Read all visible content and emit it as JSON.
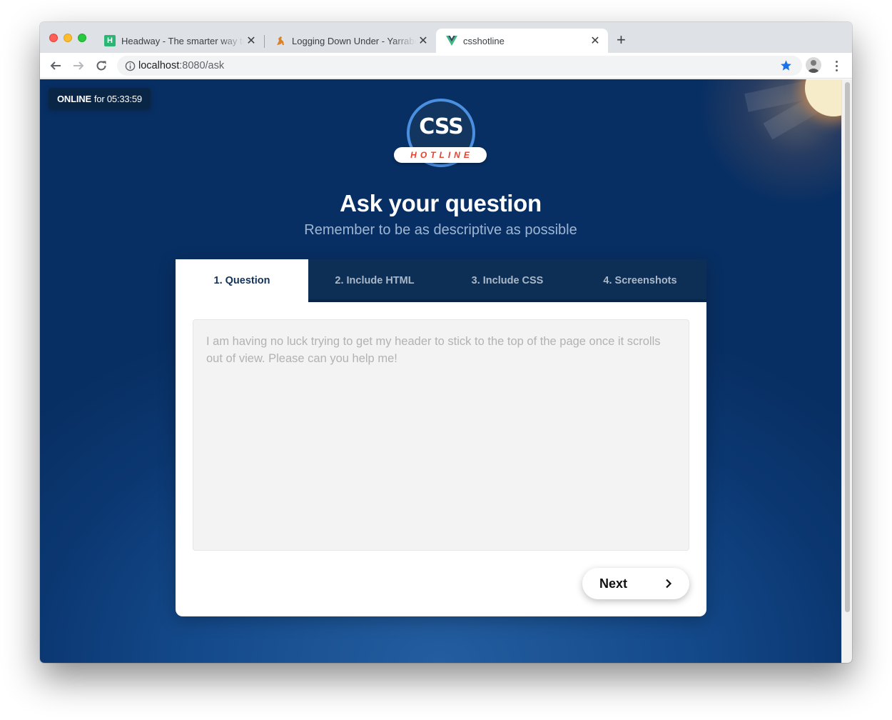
{
  "browser": {
    "tabs": [
      {
        "title": "Headway - The smarter way to",
        "active": false,
        "favicon": "headway-icon"
      },
      {
        "title": "Logging Down Under - Yarraberg",
        "active": false,
        "favicon": "kangaroo-icon"
      },
      {
        "title": "csshotline",
        "active": true,
        "favicon": "vue-icon"
      }
    ],
    "close_glyph": "✕",
    "new_tab_glyph": "+",
    "url_host": "localhost",
    "url_rest": ":8080/ask"
  },
  "page": {
    "status_state": "ONLINE",
    "status_duration": "for 05:33:59",
    "logo_main": "CSS",
    "logo_sub": "HOTLINE",
    "title": "Ask your question",
    "subtitle": "Remember to be as descriptive as possible",
    "steps": [
      {
        "label": "1. Question",
        "active": true
      },
      {
        "label": "2. Include HTML",
        "active": false
      },
      {
        "label": "3. Include CSS",
        "active": false
      },
      {
        "label": "4. Screenshots",
        "active": false
      }
    ],
    "question_placeholder": "I am having no luck trying to get my header to stick to the top of the page once it scrolls out of view. Please can you help me!",
    "next_label": "Next"
  },
  "colors": {
    "background_dark": "#082f63",
    "background_light": "#245ea0",
    "tab_bar": "#0d2e55",
    "logo_ring": "#4a8fe0",
    "logo_sub": "#e8402f"
  }
}
